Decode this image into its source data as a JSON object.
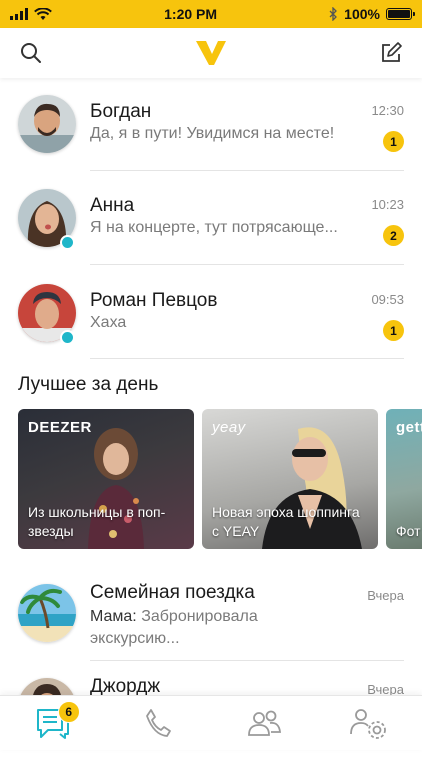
{
  "status_bar": {
    "time": "1:20 PM",
    "battery": "100%",
    "battery_level": 1.0
  },
  "header": {
    "search_icon": "search-icon",
    "logo_icon": "yeay-logo-icon",
    "compose_icon": "compose-icon"
  },
  "chats": [
    {
      "name": "Богдан",
      "message": "Да, я в пути! Увидимся на месте!",
      "time": "12:30",
      "unread": "1",
      "online": false
    },
    {
      "name": "Анна",
      "message": "Я на концерте, тут потрясающе...",
      "time": "10:23",
      "unread": "2",
      "online": true
    },
    {
      "name": "Роман Певцов",
      "message": "Хаха",
      "time": "09:53",
      "unread": "1",
      "online": true
    }
  ],
  "best_of_day": {
    "title": "Лучшее за день",
    "cards": [
      {
        "logo": "DEEZER",
        "caption": "Из школьницы в поп-звезды"
      },
      {
        "logo": "yeay",
        "caption": "Новая эпоха шоппинга с YEAY"
      },
      {
        "logo": "gett",
        "caption": "Фот на с"
      }
    ]
  },
  "group_chat": {
    "name": "Семейная поездка",
    "time": "Вчера",
    "sender": "Мама:",
    "message": " Забронировала экскурсию..."
  },
  "partial_chat": {
    "name": "Джордж",
    "time": "Вчера"
  },
  "tabbar": {
    "chats_badge": "6",
    "tabs": [
      "chats-icon",
      "phone-icon",
      "contacts-icon",
      "settings-icon"
    ]
  },
  "colors": {
    "accent": "#f7c40d",
    "online": "#1fb6c9",
    "tab_active": "#1fb6c9"
  }
}
